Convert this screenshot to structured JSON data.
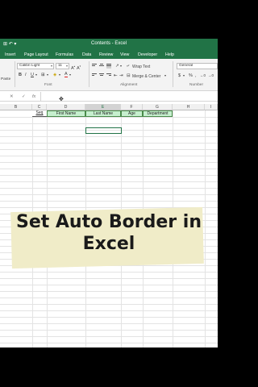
{
  "titlebar": {
    "title": "Contents - Excel",
    "qa": "⊞ ↶ ▾"
  },
  "menu": [
    "Insert",
    "Page Layout",
    "Formulas",
    "Data",
    "Review",
    "View",
    "Developer",
    "Help"
  ],
  "ribbon": {
    "font_name": "Calibri Light",
    "font_size": "11",
    "paste_label": "Paste",
    "font_group": "Font",
    "wrap_text": "Wrap Text",
    "merge_center": "Merge & Center",
    "alignment_group": "Alignment",
    "number_format": "General",
    "number_group": "Number"
  },
  "formula_bar": {
    "cancel": "✕",
    "enter": "✓",
    "fx": "fx"
  },
  "columns": [
    "B",
    "C",
    "D",
    "E",
    "F",
    "G",
    "H",
    "I"
  ],
  "selected_column": "E",
  "table_headers": [
    "Seq",
    "First Name",
    "Last Name",
    "Age",
    "Department"
  ],
  "colors": {
    "excel_green": "#217346",
    "header_fill": "#c6efce",
    "banner": "#f0ecc8"
  },
  "banner": {
    "line1": "Set Auto Border in",
    "line2": "Excel"
  }
}
